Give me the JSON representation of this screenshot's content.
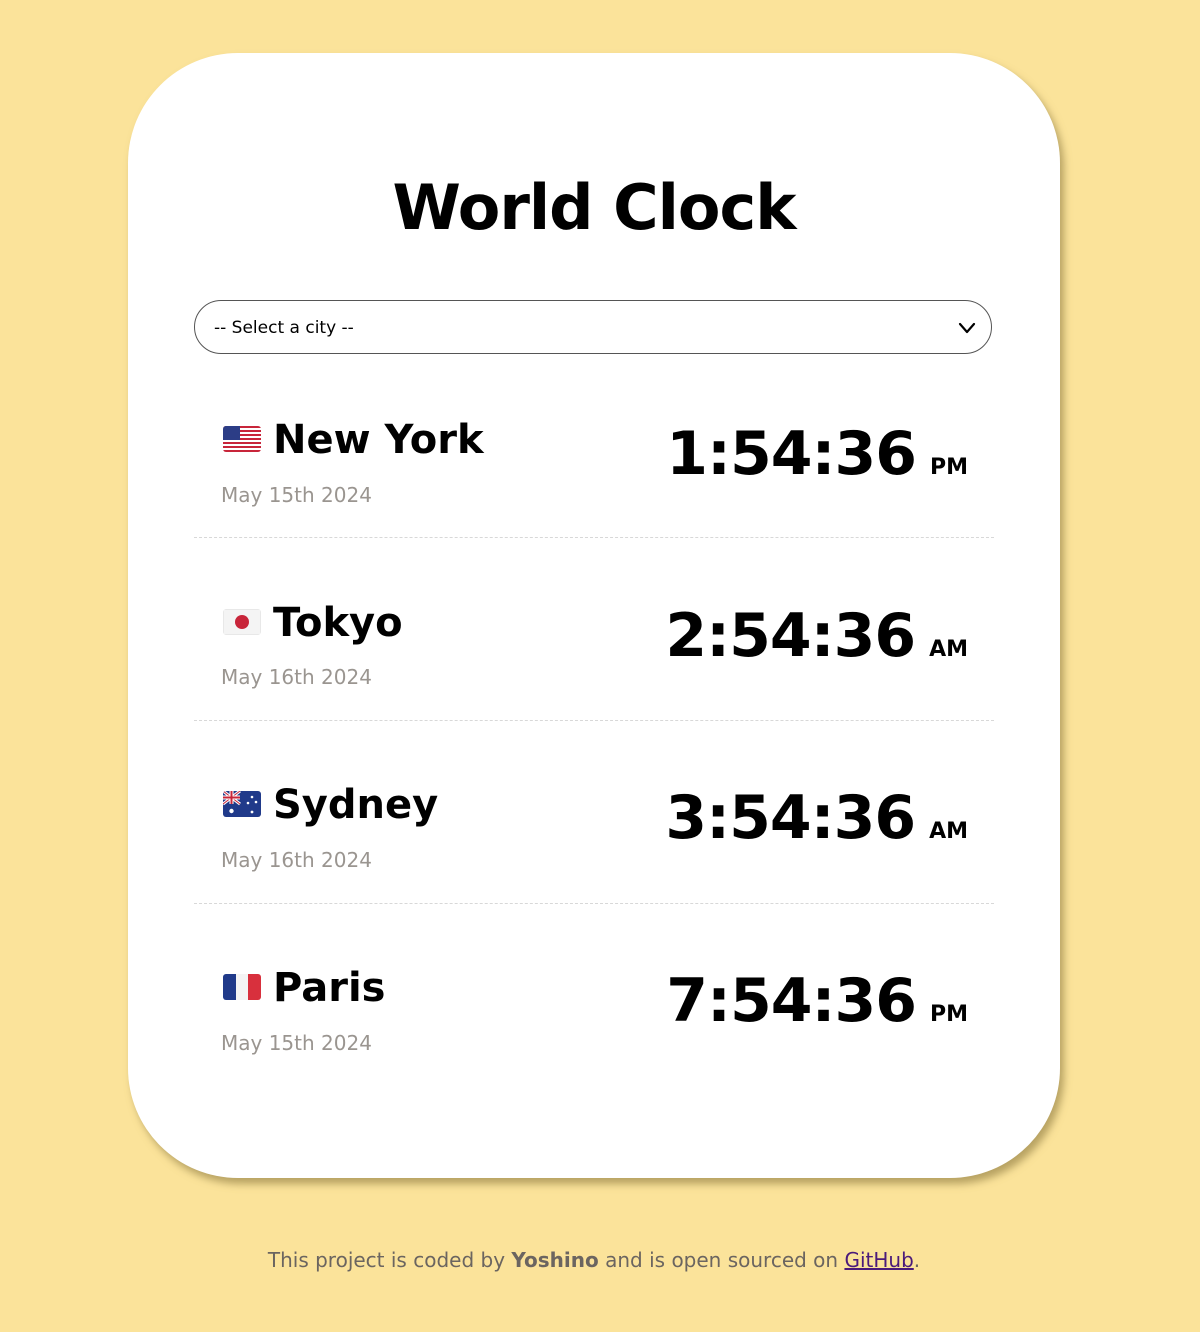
{
  "app": {
    "title": "World Clock"
  },
  "select": {
    "placeholder": "-- Select a city --"
  },
  "cities": [
    {
      "flag": "us-flag",
      "name": "New York",
      "date": "May 15th 2024",
      "time": "1:54:36",
      "period": "PM"
    },
    {
      "flag": "jp-flag",
      "name": "Tokyo",
      "date": "May 16th 2024",
      "time": "2:54:36",
      "period": "AM"
    },
    {
      "flag": "au-flag",
      "name": "Sydney",
      "date": "May 16th 2024",
      "time": "3:54:36",
      "period": "AM"
    },
    {
      "flag": "fr-flag",
      "name": "Paris",
      "date": "May 15th 2024",
      "time": "7:54:36",
      "period": "PM"
    }
  ],
  "footer": {
    "prefix": "This project is coded by ",
    "author": "Yoshino",
    "middle": " and is open sourced on ",
    "link_text": "GitHub",
    "suffix": "."
  },
  "colors": {
    "background": "#fbe39a",
    "card": "#ffffff",
    "date_text": "#9a9590",
    "link": "#4b1a7a"
  }
}
